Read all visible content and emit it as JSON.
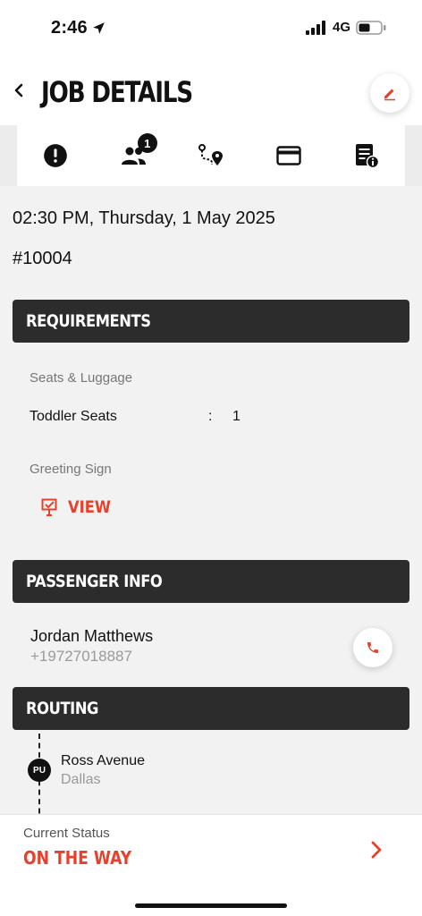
{
  "status_bar": {
    "time": "2:46",
    "network": "4G",
    "icons": [
      "location-arrow-icon",
      "signal-bars-icon",
      "battery-icon"
    ]
  },
  "header": {
    "title": "JOB DETAILS",
    "back_icon": "chevron-left-icon",
    "edit_icon": "pencil-icon"
  },
  "tabs": [
    {
      "icon": "alert-circle-icon"
    },
    {
      "icon": "people-icon",
      "badge": "1"
    },
    {
      "icon": "route-pin-icon"
    },
    {
      "icon": "credit-card-icon"
    },
    {
      "icon": "invoice-info-icon"
    }
  ],
  "job": {
    "datetime": "02:30 PM, Thursday, 1 May 2025",
    "number": "#10004"
  },
  "requirements": {
    "title": "REQUIREMENTS",
    "seats_label": "Seats & Luggage",
    "seat_item": "Toddler Seats",
    "separator": ":",
    "seat_value": "1",
    "greeting_label": "Greeting Sign",
    "view_label": "VIEW"
  },
  "passenger": {
    "title": "PASSENGER INFO",
    "name": "Jordan Matthews",
    "phone": "+19727018887"
  },
  "routing": {
    "title": "ROUTING",
    "stop_badge": "PU",
    "stop_name": "Ross Avenue",
    "stop_city": "Dallas"
  },
  "footer": {
    "status_label": "Current Status",
    "status_value": "ON THE WAY"
  },
  "colors": {
    "accent": "#e8402a",
    "section_header": "#2c2c2c",
    "background": "#f2f2f2"
  }
}
